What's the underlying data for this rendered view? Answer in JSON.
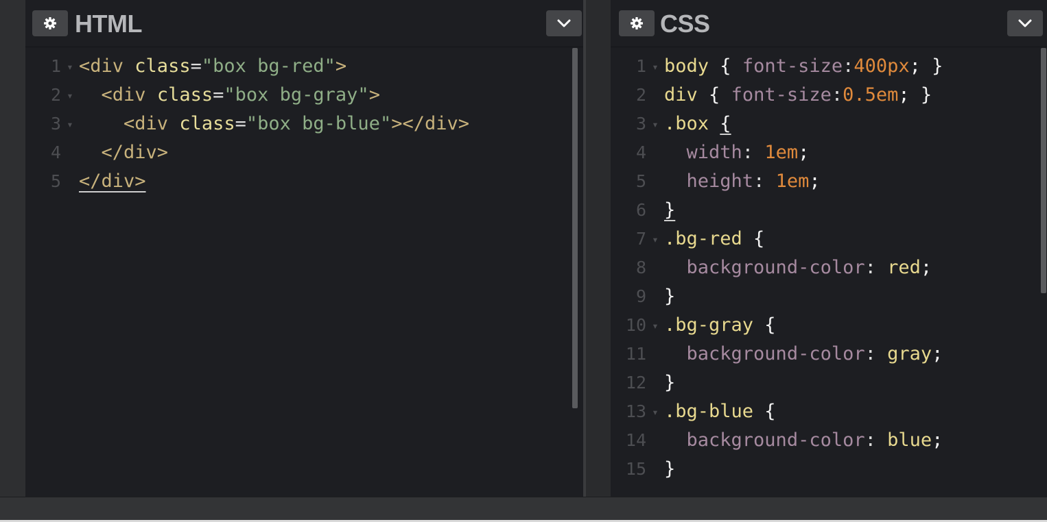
{
  "html_panel": {
    "title": "HTML",
    "settings_icon": "gear-icon",
    "collapse_icon": "chevron-down-icon",
    "lines": [
      {
        "n": "1",
        "fold": true,
        "indent": 0,
        "tokens": [
          {
            "t": "tag",
            "v": "<div"
          },
          {
            "t": "punct",
            "v": " "
          },
          {
            "t": "attr",
            "v": "class"
          },
          {
            "t": "punct",
            "v": "="
          },
          {
            "t": "str",
            "v": "\"box bg-red\""
          },
          {
            "t": "tag",
            "v": ">"
          }
        ]
      },
      {
        "n": "2",
        "fold": true,
        "indent": 2,
        "tokens": [
          {
            "t": "tag",
            "v": "<div"
          },
          {
            "t": "punct",
            "v": " "
          },
          {
            "t": "attr",
            "v": "class"
          },
          {
            "t": "punct",
            "v": "="
          },
          {
            "t": "str",
            "v": "\"box bg-gray\""
          },
          {
            "t": "tag",
            "v": ">"
          }
        ]
      },
      {
        "n": "3",
        "fold": true,
        "indent": 4,
        "tokens": [
          {
            "t": "tag",
            "v": "<div"
          },
          {
            "t": "punct",
            "v": " "
          },
          {
            "t": "attr",
            "v": "class"
          },
          {
            "t": "punct",
            "v": "="
          },
          {
            "t": "str",
            "v": "\"box bg-blue\""
          },
          {
            "t": "tag",
            "v": "></div>"
          }
        ]
      },
      {
        "n": "4",
        "fold": false,
        "indent": 2,
        "tokens": [
          {
            "t": "tag",
            "v": "</div>"
          }
        ]
      },
      {
        "n": "5",
        "fold": false,
        "indent": 0,
        "tokens": [
          {
            "t": "tag",
            "v": "</div>",
            "u": true
          }
        ]
      }
    ]
  },
  "css_panel": {
    "title": "CSS",
    "settings_icon": "gear-icon",
    "collapse_icon": "chevron-down-icon",
    "lines": [
      {
        "n": "1",
        "fold": true,
        "indent": 0,
        "tokens": [
          {
            "t": "sel",
            "v": "body"
          },
          {
            "t": "brace",
            "v": " { "
          },
          {
            "t": "prop",
            "v": "font-size"
          },
          {
            "t": "punct",
            "v": ":"
          },
          {
            "t": "num",
            "v": "400px"
          },
          {
            "t": "brace",
            "v": "; }"
          }
        ]
      },
      {
        "n": "2",
        "fold": false,
        "indent": 0,
        "tokens": [
          {
            "t": "sel",
            "v": "div"
          },
          {
            "t": "brace",
            "v": " { "
          },
          {
            "t": "prop",
            "v": "font-size"
          },
          {
            "t": "punct",
            "v": ":"
          },
          {
            "t": "num",
            "v": "0.5em"
          },
          {
            "t": "brace",
            "v": "; }"
          }
        ]
      },
      {
        "n": "3",
        "fold": true,
        "indent": 0,
        "tokens": [
          {
            "t": "sel",
            "v": ".box"
          },
          {
            "t": "brace",
            "v": " "
          },
          {
            "t": "brace",
            "v": "{",
            "u": true
          }
        ]
      },
      {
        "n": "4",
        "fold": false,
        "indent": 2,
        "tokens": [
          {
            "t": "prop",
            "v": "width"
          },
          {
            "t": "punct",
            "v": ": "
          },
          {
            "t": "num",
            "v": "1em"
          },
          {
            "t": "brace",
            "v": ";"
          }
        ]
      },
      {
        "n": "5",
        "fold": false,
        "indent": 2,
        "tokens": [
          {
            "t": "prop",
            "v": "height"
          },
          {
            "t": "punct",
            "v": ": "
          },
          {
            "t": "num",
            "v": "1em"
          },
          {
            "t": "brace",
            "v": ";"
          }
        ]
      },
      {
        "n": "6",
        "fold": false,
        "indent": 0,
        "tokens": [
          {
            "t": "brace",
            "v": "}",
            "u": true
          }
        ]
      },
      {
        "n": "7",
        "fold": true,
        "indent": 0,
        "tokens": [
          {
            "t": "sel",
            "v": ".bg-red"
          },
          {
            "t": "brace",
            "v": " {"
          }
        ]
      },
      {
        "n": "8",
        "fold": false,
        "indent": 2,
        "tokens": [
          {
            "t": "prop",
            "v": "background-color"
          },
          {
            "t": "punct",
            "v": ": "
          },
          {
            "t": "val",
            "v": "red"
          },
          {
            "t": "brace",
            "v": ";"
          }
        ]
      },
      {
        "n": "9",
        "fold": false,
        "indent": 0,
        "tokens": [
          {
            "t": "brace",
            "v": "}"
          }
        ]
      },
      {
        "n": "10",
        "fold": true,
        "indent": 0,
        "tokens": [
          {
            "t": "sel",
            "v": ".bg-gray"
          },
          {
            "t": "brace",
            "v": " {"
          }
        ]
      },
      {
        "n": "11",
        "fold": false,
        "indent": 2,
        "tokens": [
          {
            "t": "prop",
            "v": "background-color"
          },
          {
            "t": "punct",
            "v": ": "
          },
          {
            "t": "val",
            "v": "gray"
          },
          {
            "t": "brace",
            "v": ";"
          }
        ]
      },
      {
        "n": "12",
        "fold": false,
        "indent": 0,
        "tokens": [
          {
            "t": "brace",
            "v": "}"
          }
        ]
      },
      {
        "n": "13",
        "fold": true,
        "indent": 0,
        "tokens": [
          {
            "t": "sel",
            "v": ".bg-blue"
          },
          {
            "t": "brace",
            "v": " {"
          }
        ]
      },
      {
        "n": "14",
        "fold": false,
        "indent": 2,
        "tokens": [
          {
            "t": "prop",
            "v": "background-color"
          },
          {
            "t": "punct",
            "v": ": "
          },
          {
            "t": "val",
            "v": "blue"
          },
          {
            "t": "brace",
            "v": ";"
          }
        ]
      },
      {
        "n": "15",
        "fold": false,
        "indent": 0,
        "tokens": [
          {
            "t": "brace",
            "v": "}"
          }
        ]
      }
    ]
  }
}
